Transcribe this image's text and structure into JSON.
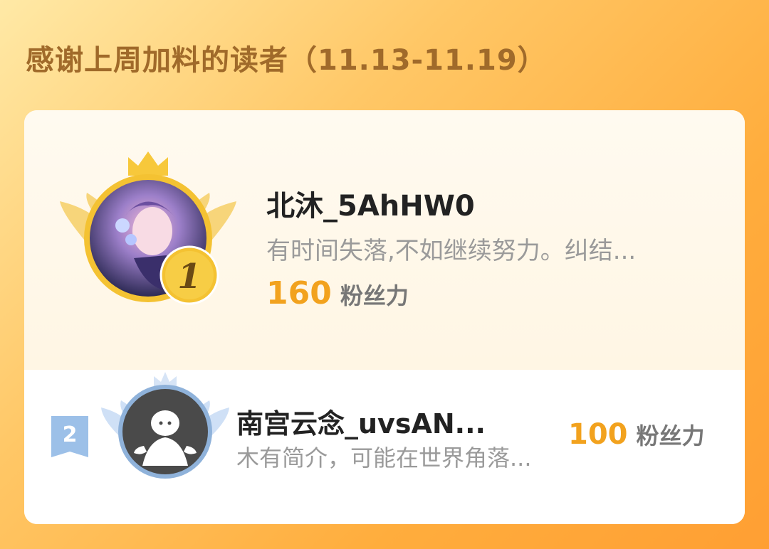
{
  "header": {
    "title": "感谢上周加料的读者（11.13-11.19）"
  },
  "readers": [
    {
      "rank": "1",
      "name": "北沐_5AhHW0",
      "bio": "有时间失落,不如继续努力。纠结...",
      "fans_value": "160",
      "fans_label": "粉丝力"
    },
    {
      "rank": "2",
      "name": "南宫云念_uvsAN...",
      "bio": "木有简介，可能在世界角落...",
      "fans_value": "100",
      "fans_label": "粉丝力"
    }
  ],
  "colors": {
    "accent": "#f2a21e",
    "gold": "#f5c23c",
    "silver": "#a8c4e6",
    "title": "#a06a2a"
  },
  "icons": [
    "crown-icon",
    "wings-icon",
    "rank-medal-icon",
    "default-avatar-icon"
  ]
}
